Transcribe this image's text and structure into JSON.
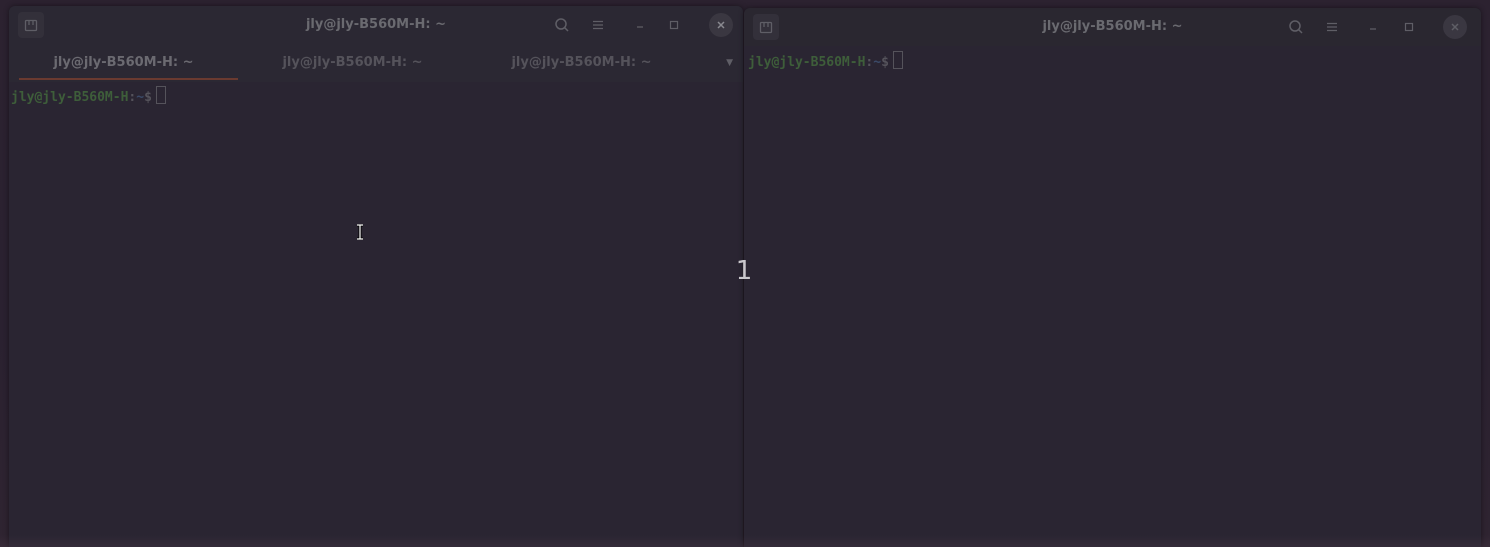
{
  "left_window": {
    "title": "jly@jly-B560M-H: ~",
    "tabs": [
      {
        "label": "jly@jly-B560M-H: ~"
      },
      {
        "label": "jly@jly-B560M-H: ~"
      },
      {
        "label": "jly@jly-B560M-H: ~"
      }
    ],
    "tab_dropdown_glyph": "▼",
    "prompt": {
      "user_host": "jly@jly-B560M-H",
      "sep": ":",
      "path": "~",
      "dollar": "$"
    }
  },
  "right_window": {
    "title": "jly@jly-B560M-H: ~",
    "prompt": {
      "user_host": "jly@jly-B560M-H",
      "sep": ":",
      "path": "~",
      "dollar": "$"
    }
  },
  "overlay": {
    "number": "1"
  },
  "icons": {
    "new_tab": "new-tab-icon",
    "search": "search-icon",
    "menu": "hamburger-menu-icon",
    "minimize": "minimize-icon",
    "maximize": "maximize-icon",
    "close": "close-icon"
  },
  "colors": {
    "terminal_bg": "#2a2532",
    "prompt_user": "#3e5e3a",
    "prompt_path": "#3b4a68",
    "active_tab_underline": "#6a3a30"
  }
}
